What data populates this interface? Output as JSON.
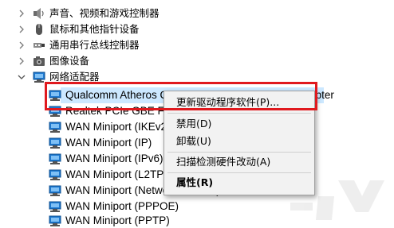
{
  "tree": {
    "categories": [
      {
        "label": "声音、视频和游戏控制器",
        "icon": "speaker-icon",
        "expanded": false
      },
      {
        "label": "鼠标和其他指针设备",
        "icon": "mouse-icon",
        "expanded": false
      },
      {
        "label": "通用串行总线控制器",
        "icon": "usb-icon",
        "expanded": false
      },
      {
        "label": "图像设备",
        "icon": "camera-icon",
        "expanded": false
      },
      {
        "label": "网络适配器",
        "icon": "network-adapter-icon",
        "expanded": true
      }
    ],
    "adapters": [
      {
        "label": "Qualcomm Atheros QCA9377 Wireless Network Adapter",
        "selected": true
      },
      {
        "label": "Realtek PCIe GBE Family Controller",
        "selected": false
      },
      {
        "label": "WAN Miniport (IKEv2)",
        "selected": false
      },
      {
        "label": "WAN Miniport (IP)",
        "selected": false
      },
      {
        "label": "WAN Miniport (IPv6)",
        "selected": false
      },
      {
        "label": "WAN Miniport (L2TP)",
        "selected": false
      },
      {
        "label": "WAN Miniport (Network Monitor)",
        "selected": false
      },
      {
        "label": "WAN Miniport (PPPOE)",
        "selected": false
      },
      {
        "label": "WAN Miniport (PPTP)",
        "selected": false
      }
    ]
  },
  "context_menu": {
    "items": [
      {
        "label": "更新驱动程序软件(P)...",
        "bold": false
      },
      {
        "label": "禁用(D)",
        "bold": false
      },
      {
        "label": "卸载(U)",
        "bold": false
      },
      {
        "label": "扫描检测硬件改动(A)",
        "bold": false
      },
      {
        "label": "属性(R)",
        "bold": true
      }
    ]
  },
  "colors": {
    "selection": "#cce8ff",
    "highlight_box": "#e0191e",
    "menu_bg": "#f2f2f2",
    "adapter_icon": "#1f7ad1"
  }
}
